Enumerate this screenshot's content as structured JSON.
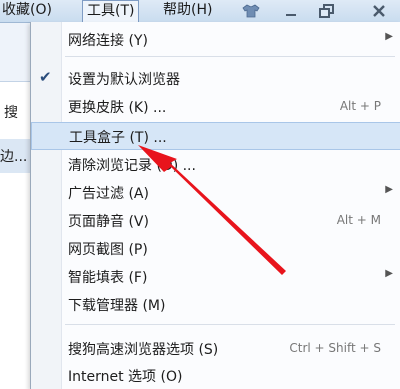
{
  "menubar": {
    "favorites_label": "收藏(O)",
    "tools_label": "工具(T)",
    "help_label": "帮助(H)"
  },
  "left_fragments": {
    "search_fragment": "搜",
    "side_fragment": "边..."
  },
  "menu": {
    "items": [
      {
        "label": "网络连接 (Y)",
        "shortcut": "",
        "submenu": true
      },
      {
        "label": "设置为默认浏览器",
        "shortcut": "",
        "checked": true
      },
      {
        "label": "更换皮肤 (K) ...",
        "shortcut": "Alt + P"
      },
      {
        "label": "工具盒子 (T) ...",
        "shortcut": "",
        "highlighted": true
      },
      {
        "label": "清除浏览记录 (D) ...",
        "shortcut": ""
      },
      {
        "label": "广告过滤 (A)",
        "shortcut": "",
        "submenu": true
      },
      {
        "label": "页面静音 (V)",
        "shortcut": "Alt + M"
      },
      {
        "label": "网页截图 (P)",
        "shortcut": ""
      },
      {
        "label": "智能填表 (F)",
        "shortcut": "",
        "submenu": true
      },
      {
        "label": "下载管理器 (M)",
        "shortcut": ""
      },
      {
        "label": "搜狗高速浏览器选项 (S)",
        "shortcut": "Ctrl + Shift + S"
      },
      {
        "label": "Internet 选项 (O)",
        "shortcut": ""
      }
    ]
  },
  "colors": {
    "highlight": "#d6e6f7",
    "arrow": "#e8141c"
  },
  "icons": {
    "skin": "tshirt-icon",
    "minimize": "minimize-icon",
    "restore": "restore-icon",
    "close": "close-icon"
  }
}
